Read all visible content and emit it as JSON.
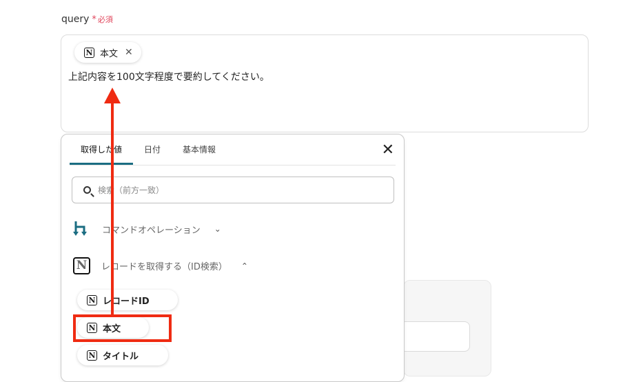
{
  "field": {
    "name": "query",
    "star": "*",
    "required": "必須"
  },
  "query_box": {
    "chip_label": "本文",
    "chip_icon": "notion-icon",
    "chip_close": "✕",
    "text": "上記内容を100文字程度で要約してください。"
  },
  "panel": {
    "tabs": [
      {
        "label": "取得した値",
        "active": true
      },
      {
        "label": "日付",
        "active": false
      },
      {
        "label": "基本情報",
        "active": false
      }
    ],
    "close": "✕",
    "search_placeholder": "検索（前方一致）",
    "sections": [
      {
        "label": "コマンドオペレーション",
        "icon": "yoom-operation-icon",
        "chevron": "⌄",
        "expanded": false
      },
      {
        "label": "レコードを取得する（ID検索）",
        "icon": "notion-icon",
        "chevron": "⌃",
        "expanded": true
      }
    ],
    "items": [
      {
        "label": "レコードID"
      },
      {
        "label": "本文"
      },
      {
        "label": "タイトル"
      }
    ]
  },
  "colors": {
    "accent": "#1b6d82",
    "required": "#e0455b",
    "annotation": "#ef2b12"
  }
}
